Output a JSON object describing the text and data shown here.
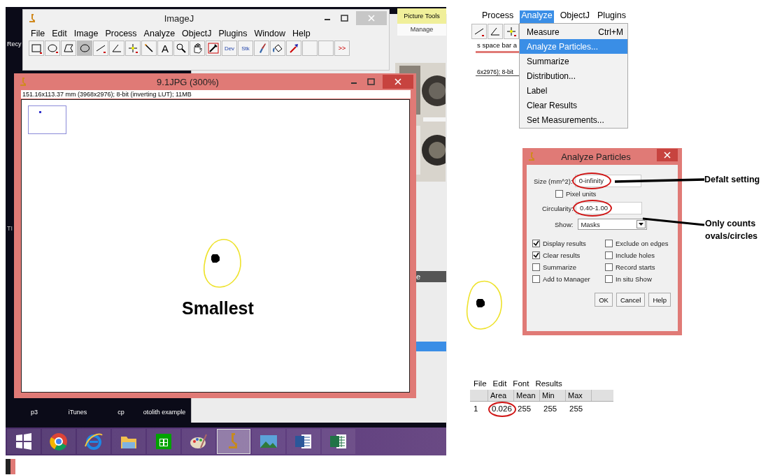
{
  "desktop": {
    "icons": [
      {
        "label": "Recy"
      },
      {
        "label": "p3"
      },
      {
        "label": "iTunes"
      },
      {
        "label": "cp"
      },
      {
        "label": "otolith example"
      }
    ],
    "side_label": "TI",
    "ribbon": {
      "tab": "Picture Tools",
      "subtab": "Manage"
    },
    "background_table": {
      "header": "e"
    },
    "taskbar": [
      {
        "kind": "start",
        "selected": false
      },
      {
        "kind": "chrome",
        "selected": false
      },
      {
        "kind": "ie",
        "selected": false
      },
      {
        "kind": "folder",
        "selected": false
      },
      {
        "kind": "store",
        "selected": false
      },
      {
        "kind": "paint",
        "selected": false
      },
      {
        "kind": "imagej",
        "selected": true
      },
      {
        "kind": "photos",
        "selected": false
      },
      {
        "kind": "word",
        "selected": false
      },
      {
        "kind": "excel",
        "selected": false
      }
    ]
  },
  "imagej_window": {
    "title": "ImageJ",
    "menu": [
      "File",
      "Edit",
      "Image",
      "Process",
      "Analyze",
      "ObjectJ",
      "Plugins",
      "Window",
      "Help"
    ],
    "tools": [
      {
        "kind": "rect",
        "selected": false
      },
      {
        "kind": "oval",
        "selected": false
      },
      {
        "kind": "polygon",
        "selected": false
      },
      {
        "kind": "freehand",
        "selected": true
      },
      {
        "kind": "line",
        "selected": false
      },
      {
        "kind": "angle",
        "selected": false
      },
      {
        "kind": "point",
        "selected": false
      },
      {
        "kind": "wand",
        "selected": false
      },
      {
        "kind": "text",
        "label": "A",
        "selected": false
      },
      {
        "kind": "zoom",
        "selected": false
      },
      {
        "kind": "hand",
        "selected": false
      },
      {
        "kind": "dropper",
        "selected": false
      },
      {
        "kind": "menu",
        "label": "Dev",
        "selected": false
      },
      {
        "kind": "menu",
        "label": "Stk",
        "selected": false
      },
      {
        "kind": "brush",
        "selected": false
      },
      {
        "kind": "flood",
        "selected": false
      },
      {
        "kind": "arrow",
        "selected": false
      },
      {
        "kind": "blank",
        "selected": false
      },
      {
        "kind": "blank",
        "selected": false
      },
      {
        "kind": "more",
        "label": ">>",
        "selected": false
      }
    ]
  },
  "image_window": {
    "title": "9.1JPG (300%)",
    "info": "151.16x113.37 mm (3968x2976); 8-bit (inverting LUT); 11MB",
    "caption": "Smallest"
  },
  "analyze_menu": {
    "menubar": [
      {
        "label": "Process",
        "selected": false
      },
      {
        "label": "Analyze",
        "selected": true
      },
      {
        "label": "ObjectJ",
        "selected": false
      },
      {
        "label": "Plugins",
        "selected": false
      }
    ],
    "status_text": "s space bar a",
    "info_text": "6x2976); 8-bit",
    "items": [
      {
        "label": "Measure",
        "shortcut": "Ctrl+M",
        "selected": false
      },
      {
        "label": "Analyze Particles...",
        "selected": true
      },
      {
        "label": "Summarize",
        "selected": false
      },
      {
        "label": "Distribution...",
        "selected": false
      },
      {
        "label": "Label",
        "selected": false
      },
      {
        "label": "Clear Results",
        "selected": false
      },
      {
        "label": "Set Measurements...",
        "selected": false
      }
    ]
  },
  "dialog": {
    "title": "Analyze Particles",
    "size": {
      "label": "Size (mm^2):",
      "value": "0-infinity",
      "circled": true
    },
    "pixel_units": {
      "label": "Pixel units",
      "checked": false
    },
    "circularity": {
      "label": "Circularity:",
      "value": "0.40-1.00",
      "circled": true
    },
    "show": {
      "label": "Show:",
      "value": "Masks"
    },
    "options": [
      {
        "label": "Display results",
        "checked": true
      },
      {
        "label": "Exclude on edges",
        "checked": false
      },
      {
        "label": "Clear results",
        "checked": true
      },
      {
        "label": "Include holes",
        "checked": false
      },
      {
        "label": "Summarize",
        "checked": false
      },
      {
        "label": "Record starts",
        "checked": false
      },
      {
        "label": "Add to Manager",
        "checked": false
      },
      {
        "label": "In situ Show",
        "checked": false
      }
    ],
    "buttons": [
      "OK",
      "Cancel",
      "Help"
    ]
  },
  "annotations": [
    {
      "text": "Defalt setting"
    },
    {
      "text": "Only counts ovals/circles"
    }
  ],
  "results": {
    "menu": [
      "File",
      "Edit",
      "Font",
      "Results"
    ],
    "columns": [
      "",
      "Area",
      "Mean",
      "Min",
      "Max"
    ],
    "rows": [
      {
        "cells": [
          {
            "text": "1",
            "circled": false
          },
          {
            "text": "0.026",
            "circled": true
          },
          {
            "text": "255",
            "circled": false
          },
          {
            "text": "255",
            "circled": false
          },
          {
            "text": "255",
            "circled": false
          }
        ]
      }
    ]
  }
}
